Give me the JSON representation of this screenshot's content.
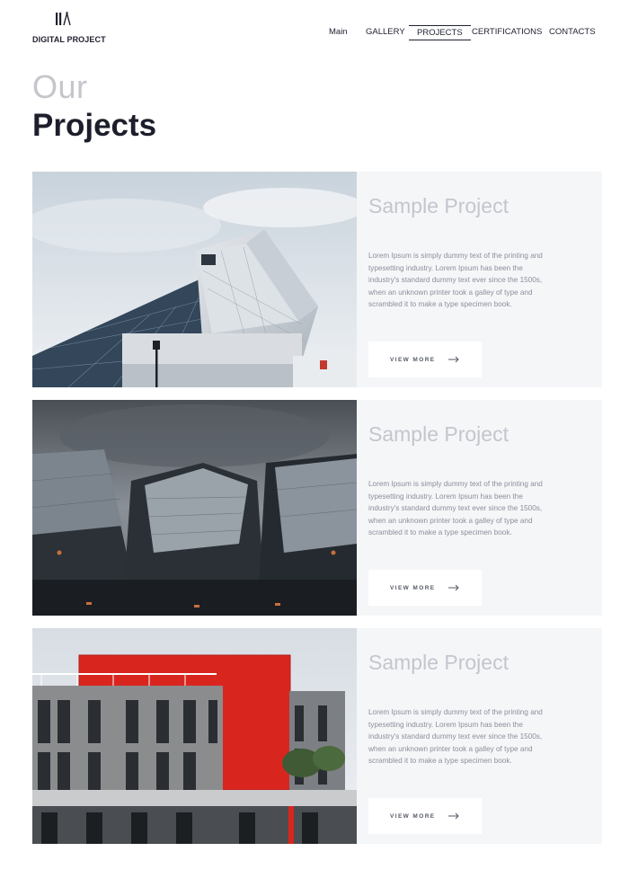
{
  "header": {
    "logo_text": "DIGITAL PROJECT",
    "logo_icon": "building-logo-icon",
    "nav": [
      {
        "label": "Main",
        "active": false
      },
      {
        "label": "GALLERY",
        "active": false
      },
      {
        "label": "PROJECTS",
        "active": true
      },
      {
        "label": "CERTIFICATIONS",
        "active": false
      },
      {
        "label": "CONTACTS",
        "active": false
      }
    ]
  },
  "heading": {
    "light": "Our",
    "bold": "Projects"
  },
  "projects": [
    {
      "title": "Sample Project",
      "description": "Lorem Ipsum is simply dummy text of the printing and typesetting industry. Lorem Ipsum has been the industry's standard dummy text ever since the 1500s, when an unknown printer took a galley of type and scrambled it to make a type specimen book.",
      "button_label": "VIEW MORE",
      "image": "glass-museum-building-photo"
    },
    {
      "title": "Sample Project",
      "description": "Lorem Ipsum is simply dummy text of the printing and typesetting industry. Lorem Ipsum has been the industry's standard dummy text ever since the 1500s, when an unknown printer took a galley of type and scrambled it to make a type specimen book.",
      "button_label": "VIEW MORE",
      "image": "skyscrapers-looking-up-photo"
    },
    {
      "title": "Sample Project",
      "description": "Lorem Ipsum is simply dummy text of the printing and typesetting industry. Lorem Ipsum has been the industry's standard dummy text ever since the 1500s, when an unknown printer took a galley of type and scrambled it to make a type specimen book.",
      "button_label": "VIEW MORE",
      "image": "red-facade-apartment-photo"
    }
  ],
  "colors": {
    "text_dark": "#1f2230",
    "heading_light": "#c4c6cc",
    "card_bg": "#f5f6f8",
    "accent_red": "#d8261f"
  }
}
